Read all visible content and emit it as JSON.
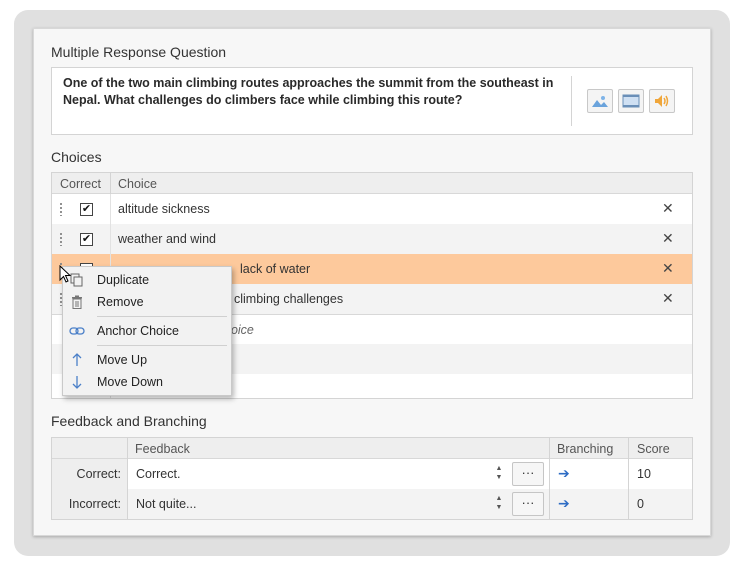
{
  "question_section": {
    "title": "Multiple Response Question",
    "text": "One of the two main climbing routes approaches the summit from the southeast in Nepal. What challenges do climbers face while climbing this route?"
  },
  "choices_section": {
    "title": "Choices",
    "col_correct": "Correct",
    "col_choice": "Choice",
    "rows": [
      {
        "label": "altitude sickness",
        "checked": true
      },
      {
        "label": "weather and wind",
        "checked": true
      },
      {
        "label": "lack of water",
        "checked": false
      },
      {
        "label": "climbing challenges",
        "checked": false
      }
    ],
    "placeholder": "hoice"
  },
  "feedback_section": {
    "title": "Feedback and Branching",
    "col_feedback": "Feedback",
    "col_branching": "Branching",
    "col_score": "Score",
    "rows": [
      {
        "label": "Correct:",
        "feedback": "Correct.",
        "score": "10"
      },
      {
        "label": "Incorrect:",
        "feedback": "Not quite...",
        "score": "0"
      }
    ],
    "ellipsis": "···"
  },
  "context_menu": {
    "duplicate": "Duplicate",
    "remove": "Remove",
    "anchor": "Anchor Choice",
    "move_up": "Move Up",
    "move_down": "Move Down"
  },
  "colors": {
    "selected_row": "#fdc99c",
    "accent_blue": "#2e6cc4"
  }
}
